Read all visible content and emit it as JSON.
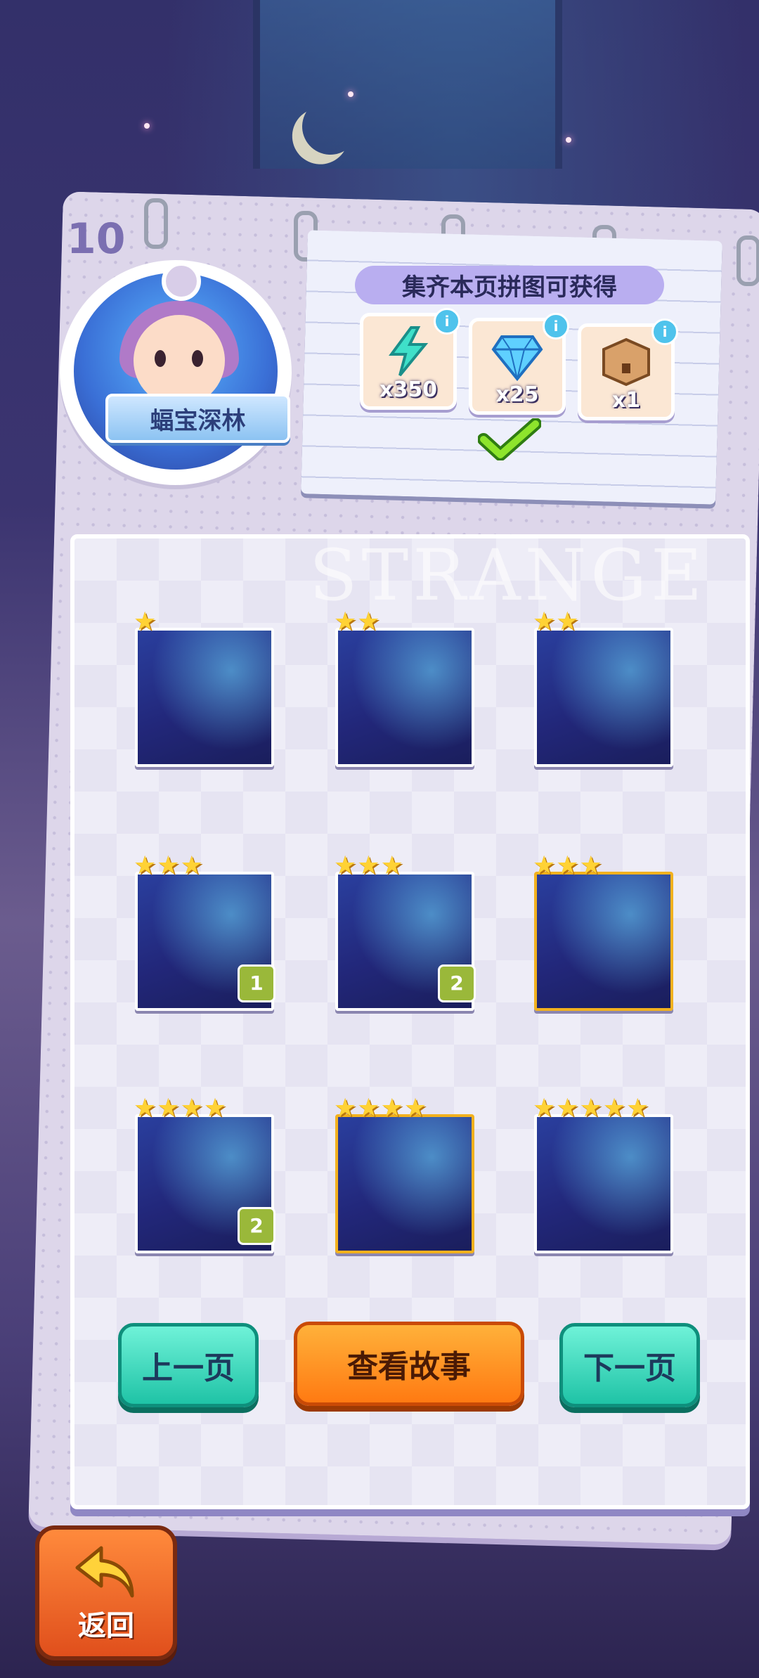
{
  "page_number": "10",
  "chapter": {
    "name": "蝠宝深林"
  },
  "rewards": {
    "title": "集齐本页拼图可获得",
    "items": [
      {
        "icon": "lightning-icon",
        "qty": "x350"
      },
      {
        "icon": "diamond-icon",
        "qty": "x25"
      },
      {
        "icon": "chest-icon",
        "qty": "x1"
      }
    ],
    "claimed_icon": "checkmark-icon"
  },
  "board_watermark": "STRANGE",
  "pieces": [
    {
      "stars": 1,
      "count": ""
    },
    {
      "stars": 2,
      "count": ""
    },
    {
      "stars": 2,
      "count": ""
    },
    {
      "stars": 3,
      "count": "1"
    },
    {
      "stars": 3,
      "count": "2"
    },
    {
      "stars": 3,
      "count": ""
    },
    {
      "stars": 4,
      "count": "2"
    },
    {
      "stars": 4,
      "count": ""
    },
    {
      "stars": 5,
      "count": ""
    }
  ],
  "buttons": {
    "prev": "上一页",
    "story": "查看故事",
    "next": "下一页"
  },
  "back_label": "返回"
}
